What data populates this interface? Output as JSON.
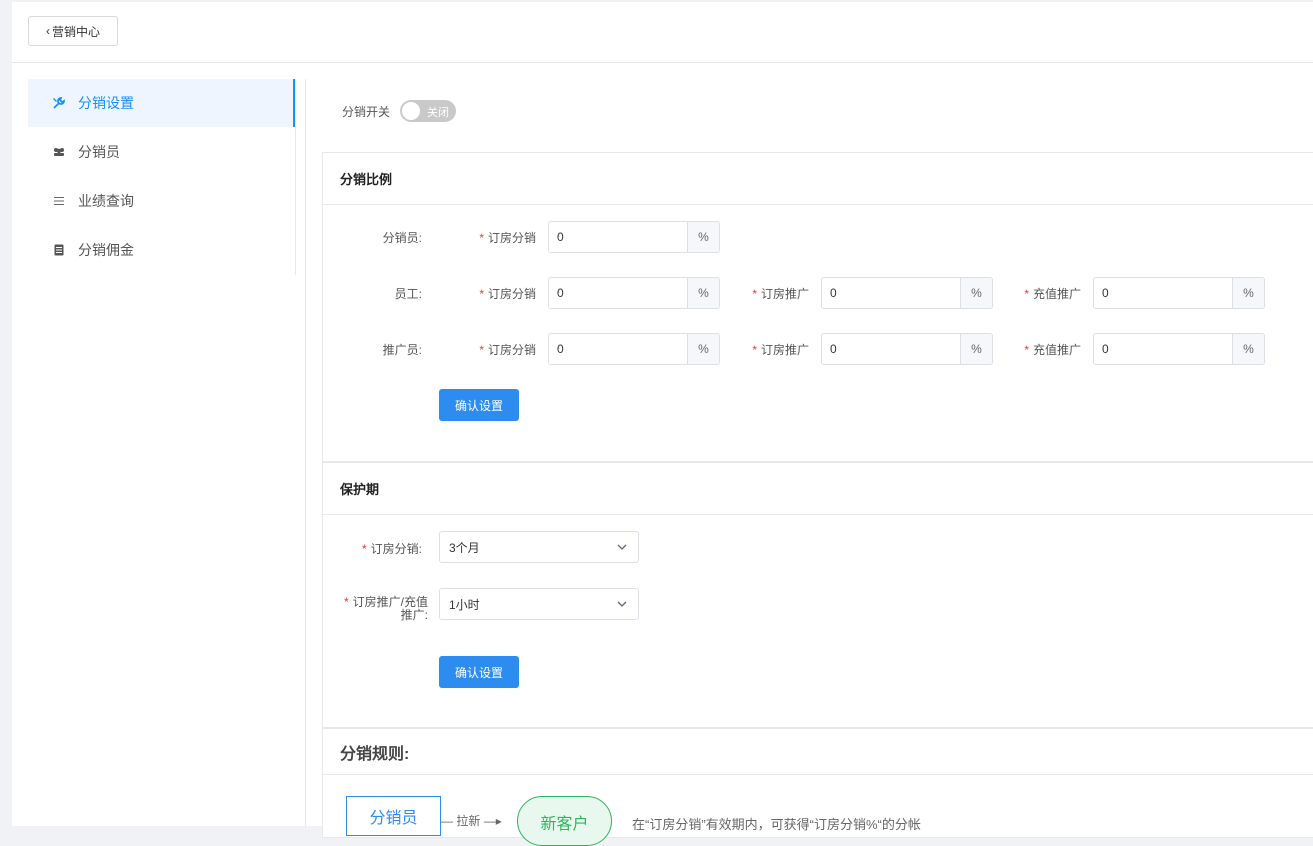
{
  "header": {
    "back_label": "营销中心"
  },
  "sidebar": {
    "items": [
      {
        "label": "分销设置",
        "icon": "tools-icon",
        "active": true
      },
      {
        "label": "分销员",
        "icon": "users-icon",
        "active": false
      },
      {
        "label": "业绩查询",
        "icon": "list-icon",
        "active": false
      },
      {
        "label": "分销佣金",
        "icon": "document-icon",
        "active": false
      }
    ]
  },
  "switch": {
    "label": "分销开关",
    "state_text": "关闭"
  },
  "ratio": {
    "title": "分销比例",
    "distributor": {
      "label": "分销员:",
      "fields": [
        {
          "label": "订房分销",
          "value": "0",
          "unit": "%"
        }
      ]
    },
    "staff": {
      "label": "员工:",
      "fields": [
        {
          "label": "订房分销",
          "value": "0",
          "unit": "%"
        },
        {
          "label": "订房推广",
          "value": "0",
          "unit": "%"
        },
        {
          "label": "充值推广",
          "value": "0",
          "unit": "%"
        }
      ]
    },
    "promoter": {
      "label": "推广员:",
      "fields": [
        {
          "label": "订房分销",
          "value": "0",
          "unit": "%"
        },
        {
          "label": "订房推广",
          "value": "0",
          "unit": "%"
        },
        {
          "label": "充值推广",
          "value": "0",
          "unit": "%"
        }
      ]
    },
    "confirm_label": "确认设置"
  },
  "protection": {
    "title": "保护期",
    "booking": {
      "label": "订房分销:",
      "value": "3个月"
    },
    "promo": {
      "label_line1": "订房推广/充值",
      "label_line2": "推广:",
      "value": "1小时"
    },
    "confirm_label": "确认设置"
  },
  "rules": {
    "title": "分销规则:",
    "box_label": "分销员",
    "arrow_label": "拉新",
    "circle_label": "新客户",
    "description": "在“订房分销”有效期内，可获得“订房分销%“的分帐"
  },
  "colors": {
    "primary": "#2d8cf0",
    "active_bg": "#eef5fe",
    "required": "#e33",
    "green": "#2db55d"
  }
}
